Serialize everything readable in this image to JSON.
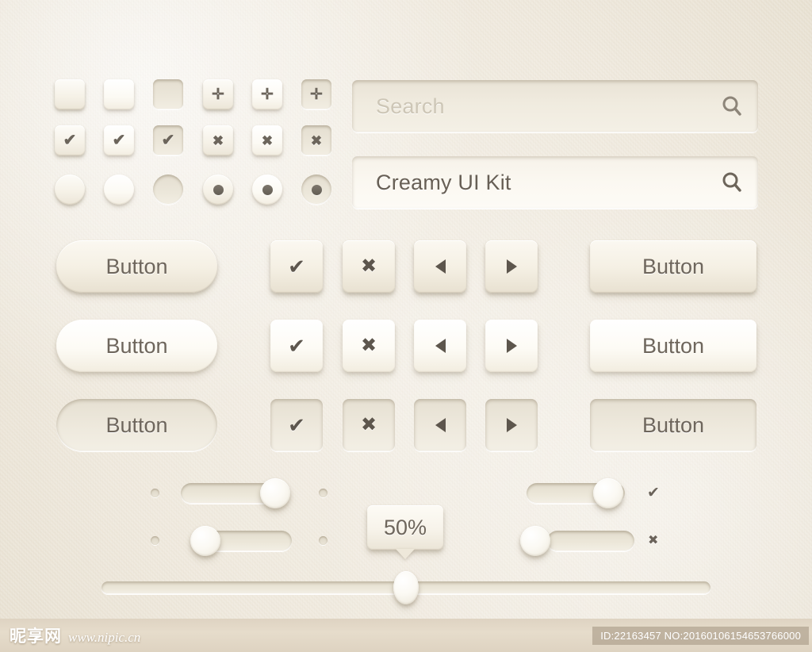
{
  "page": {
    "title": "Creamy UI Kit",
    "background_color": "#f2eee5",
    "text_color": "#6e665c",
    "glyph_color": "#5d564d",
    "placeholder_color": "#cdc6b6"
  },
  "controls_grid": {
    "rows": [
      {
        "name": "checkbox-empty-row",
        "cells": [
          {
            "shape": "square",
            "state": "normal",
            "glyph": "",
            "icon": "checkbox-empty"
          },
          {
            "shape": "square",
            "state": "hover",
            "glyph": "",
            "icon": "checkbox-empty"
          },
          {
            "shape": "square",
            "state": "pressed",
            "glyph": "",
            "icon": "checkbox-empty"
          },
          {
            "shape": "square",
            "state": "normal",
            "glyph": "✛",
            "icon": "plus-icon"
          },
          {
            "shape": "square",
            "state": "hover",
            "glyph": "✛",
            "icon": "plus-icon"
          },
          {
            "shape": "square",
            "state": "pressed",
            "glyph": "✛",
            "icon": "plus-icon"
          }
        ]
      },
      {
        "name": "checkbox-checked-row",
        "cells": [
          {
            "shape": "square",
            "state": "normal",
            "glyph": "✔",
            "icon": "check-icon"
          },
          {
            "shape": "square",
            "state": "hover",
            "glyph": "✔",
            "icon": "check-icon"
          },
          {
            "shape": "square",
            "state": "pressed",
            "glyph": "✔",
            "icon": "check-icon"
          },
          {
            "shape": "square",
            "state": "normal",
            "glyph": "✖",
            "icon": "close-icon"
          },
          {
            "shape": "square",
            "state": "hover",
            "glyph": "✖",
            "icon": "close-icon"
          },
          {
            "shape": "square",
            "state": "pressed",
            "glyph": "✖",
            "icon": "close-icon"
          }
        ]
      },
      {
        "name": "radio-row",
        "cells": [
          {
            "shape": "circle",
            "state": "normal",
            "glyph": "",
            "icon": "radio-empty"
          },
          {
            "shape": "circle",
            "state": "hover",
            "glyph": "",
            "icon": "radio-empty"
          },
          {
            "shape": "circle",
            "state": "pressed",
            "glyph": "",
            "icon": "radio-empty"
          },
          {
            "shape": "circle",
            "state": "normal",
            "glyph": "dot",
            "icon": "radio-selected"
          },
          {
            "shape": "circle",
            "state": "hover",
            "glyph": "dot",
            "icon": "radio-selected"
          },
          {
            "shape": "circle",
            "state": "pressed",
            "glyph": "dot",
            "icon": "radio-selected"
          }
        ]
      }
    ]
  },
  "search_fields": [
    {
      "name": "search-field-empty",
      "value": "",
      "placeholder": "Search",
      "state": "empty",
      "icon": "search-icon"
    },
    {
      "name": "search-field-filled",
      "value": "Creamy UI Kit",
      "placeholder": "Search",
      "state": "filled",
      "icon": "search-icon"
    }
  ],
  "button_rows": [
    {
      "state": "normal",
      "pill_label": "Button",
      "rect_label": "Button",
      "icons": [
        {
          "glyph": "✔",
          "icon": "check-icon"
        },
        {
          "glyph": "✖",
          "icon": "close-icon"
        },
        {
          "glyph": "◀",
          "icon": "arrow-left-icon"
        },
        {
          "glyph": "▶",
          "icon": "arrow-right-icon"
        }
      ]
    },
    {
      "state": "hover",
      "pill_label": "Button",
      "rect_label": "Button",
      "icons": [
        {
          "glyph": "✔",
          "icon": "check-icon"
        },
        {
          "glyph": "✖",
          "icon": "close-icon"
        },
        {
          "glyph": "◀",
          "icon": "arrow-left-icon"
        },
        {
          "glyph": "▶",
          "icon": "arrow-right-icon"
        }
      ]
    },
    {
      "state": "pressed",
      "pill_label": "Button",
      "rect_label": "Button",
      "icons": [
        {
          "glyph": "✔",
          "icon": "check-icon"
        },
        {
          "glyph": "✖",
          "icon": "close-icon"
        },
        {
          "glyph": "◀",
          "icon": "arrow-left-icon"
        },
        {
          "glyph": "▶",
          "icon": "arrow-right-icon"
        }
      ]
    }
  ],
  "toggles": [
    {
      "name": "toggle-left-on",
      "position": "right",
      "value": "on",
      "label": ""
    },
    {
      "name": "toggle-left-off",
      "position": "left",
      "value": "off",
      "label": ""
    },
    {
      "name": "toggle-right-on",
      "position": "right",
      "value": "on",
      "label": "✔",
      "label_icon": "check-icon"
    },
    {
      "name": "toggle-right-off",
      "position": "left",
      "value": "off",
      "label": "✖",
      "label_icon": "close-icon"
    }
  ],
  "tooltip": {
    "name": "value-tooltip",
    "text": "50%"
  },
  "progress_slider": {
    "name": "progress-slider",
    "value": 50,
    "min": 0,
    "max": 100,
    "value_label": "50%"
  },
  "watermark": {
    "site_cn": "昵享网",
    "site_url": "www.nipic.cn",
    "id_text": "ID:22163457 NO:20160106154653766000"
  }
}
